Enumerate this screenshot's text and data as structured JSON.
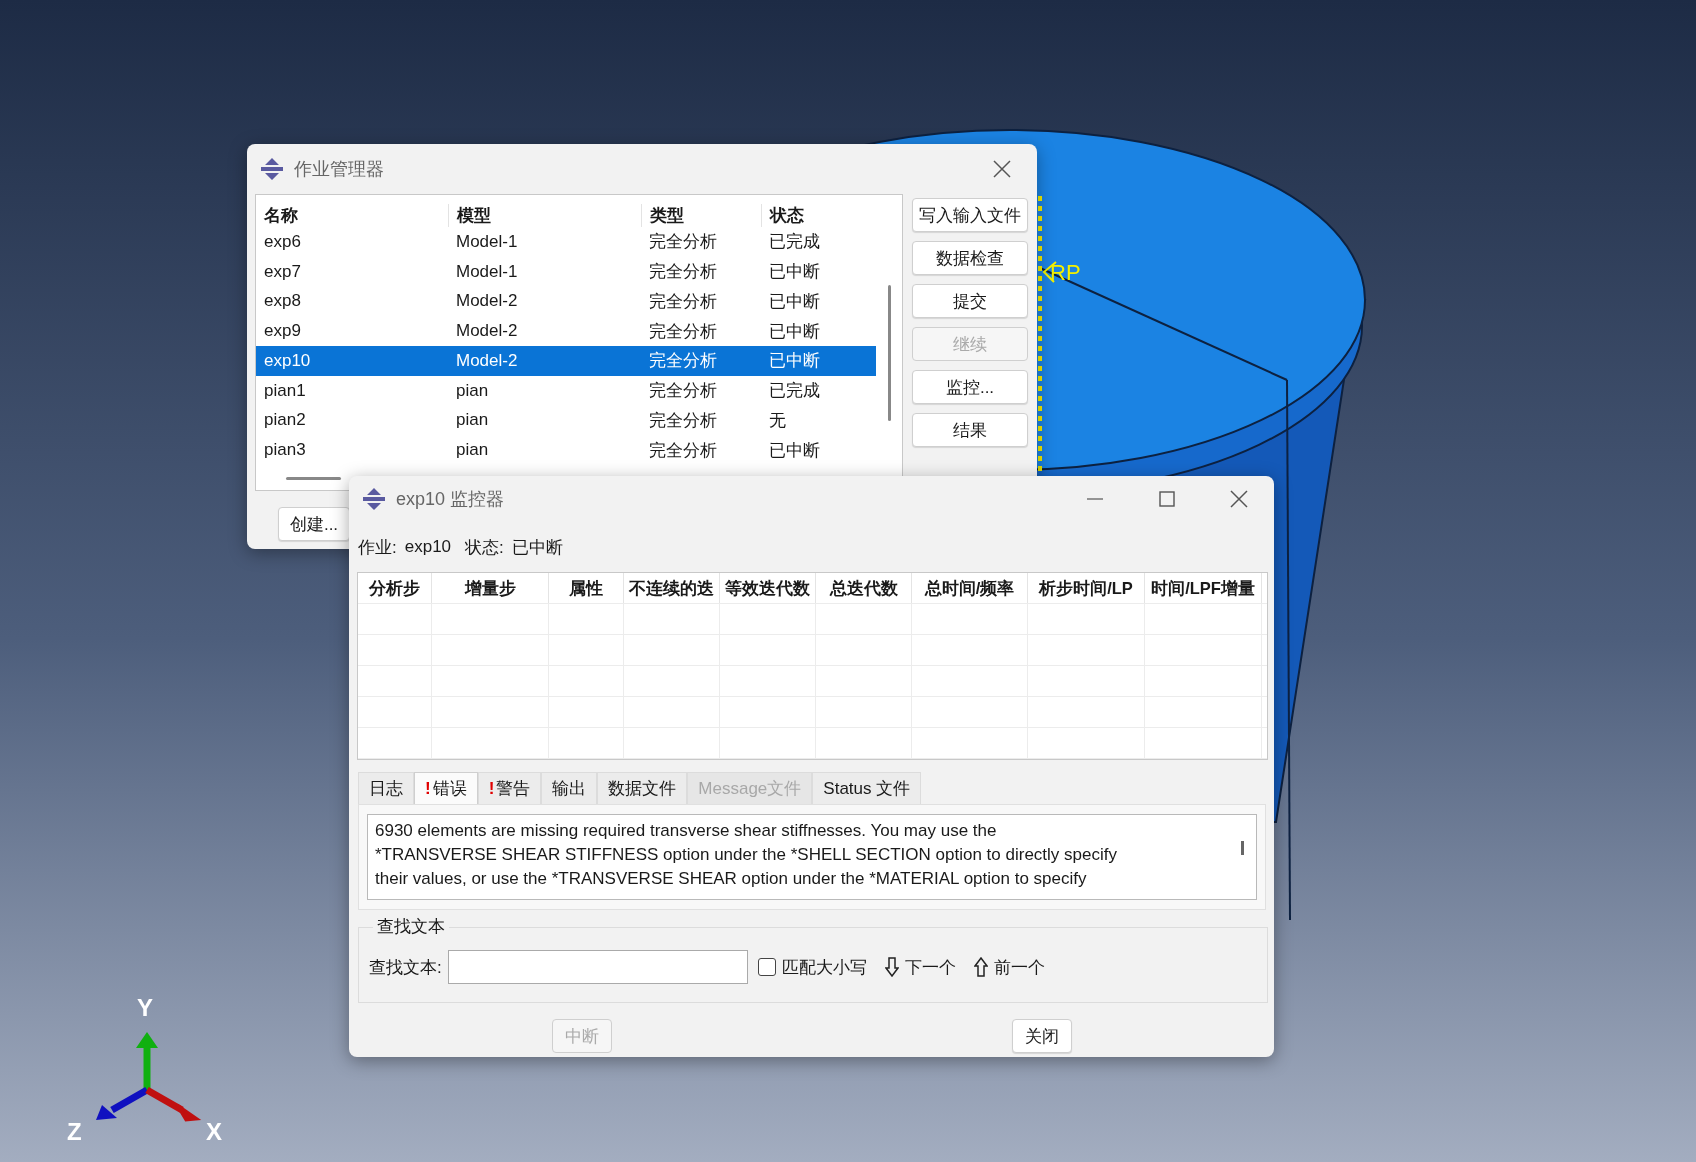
{
  "viewport": {
    "rp_label": "RP",
    "axes": {
      "x": "X",
      "y": "Y",
      "z": "Z"
    }
  },
  "job_manager": {
    "title": "作业管理器",
    "columns": [
      "名称",
      "模型",
      "类型",
      "状态"
    ],
    "rows": [
      {
        "cells": [
          "exp6",
          "Model-1",
          "完全分析",
          "已完成"
        ],
        "selected": false
      },
      {
        "cells": [
          "exp7",
          "Model-1",
          "完全分析",
          "已中断"
        ],
        "selected": false
      },
      {
        "cells": [
          "exp8",
          "Model-2",
          "完全分析",
          "已中断"
        ],
        "selected": false
      },
      {
        "cells": [
          "exp9",
          "Model-2",
          "完全分析",
          "已中断"
        ],
        "selected": false
      },
      {
        "cells": [
          "exp10",
          "Model-2",
          "完全分析",
          "已中断"
        ],
        "selected": true
      },
      {
        "cells": [
          "pian1",
          "pian",
          "完全分析",
          "已完成"
        ],
        "selected": false
      },
      {
        "cells": [
          "pian2",
          "pian",
          "完全分析",
          "无"
        ],
        "selected": false
      },
      {
        "cells": [
          "pian3",
          "pian",
          "完全分析",
          "已中断"
        ],
        "selected": false
      }
    ],
    "buttons": [
      {
        "label": "写入输入文件",
        "disabled": false
      },
      {
        "label": "数据检查",
        "disabled": false
      },
      {
        "label": "提交",
        "disabled": false
      },
      {
        "label": "继续",
        "disabled": true
      },
      {
        "label": "监控...",
        "disabled": false
      },
      {
        "label": "结果",
        "disabled": false
      }
    ],
    "create_button": "创建..."
  },
  "monitor": {
    "title": "exp10 监控器",
    "job_label": "作业:",
    "job": "exp10",
    "status_label": "状态:",
    "status": "已中断",
    "columns": [
      "分析步",
      "增量步",
      "属性",
      "不连续的迭",
      "等效迭代数",
      "总迭代数",
      "总时间/频率",
      "析步时间/LP",
      "时间/LPF增量"
    ],
    "tabs": [
      {
        "label": "日志",
        "alert": false,
        "selected": false,
        "disabled": false
      },
      {
        "label": "错误",
        "alert": true,
        "selected": true,
        "disabled": false
      },
      {
        "label": "警告",
        "alert": true,
        "selected": false,
        "disabled": false
      },
      {
        "label": "输出",
        "alert": false,
        "selected": false,
        "disabled": false
      },
      {
        "label": "数据文件",
        "alert": false,
        "selected": false,
        "disabled": false
      },
      {
        "label": "Message文件",
        "alert": false,
        "selected": false,
        "disabled": true
      },
      {
        "label": "Status 文件",
        "alert": false,
        "selected": false,
        "disabled": false
      }
    ],
    "alert_mark": "!",
    "message_lines": [
      "6930 elements are missing required transverse shear stiffnesses. You may use the",
      "*TRANSVERSE SHEAR STIFFNESS option under the *SHELL SECTION option to directly specify",
      "their values, or use the *TRANSVERSE SHEAR option under the *MATERIAL option to specify"
    ],
    "find": {
      "group_title": "查找文本",
      "label": "查找文本:",
      "match_case": {
        "label": "匹配大小写",
        "checked": false
      },
      "next": "下一个",
      "previous": "前一个"
    },
    "buttons": [
      {
        "label": "中断",
        "disabled": true
      },
      {
        "label": "关闭",
        "disabled": false
      }
    ]
  }
}
